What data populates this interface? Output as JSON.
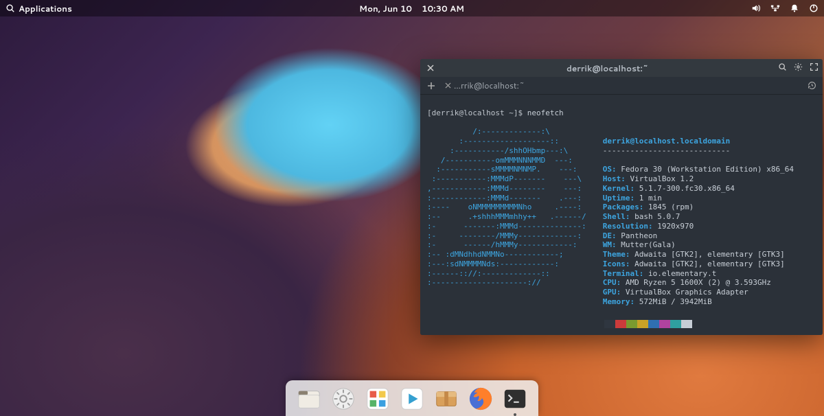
{
  "panel": {
    "applications_label": "Applications",
    "date": "Mon, Jun 10",
    "time": "10:30 AM"
  },
  "terminal": {
    "window_title": "derrik@localhost:~",
    "tab_label": "…rrik@localhost:~",
    "prompt": "[derrik@localhost ~]$",
    "command": "neofetch",
    "ascii_art": "          /:-------------:\\\n       :-------------------::\n     :-----------/shhOHbmp---:\\\n   /-----------omMMMNNNMMD  ---:\n  :-----------sMMMMNMNMP.    ---:\n :-----------:MMMdP-------    ---\\\n,------------:MMMd--------    ---:\n:------------:MMMd-------    .---:\n:----    oNMMMMMMMMMNho     .----:\n:--      .+shhhMMMmhhy++   .------/\n:-      -------:MMMd--------------:\n:-     --------/MMMy-------------:\n:-      ------/hMMMy------------:\n:-- :dMNdhhdNMMNo------------;\n:---:sdNMMMMNds:------------:\n:------:://:-------------::\n:---------------------://",
    "info_header": "derrik@localhost.localdomain",
    "info_sep": "----------------------------",
    "info": [
      {
        "label": "OS",
        "value": "Fedora 30 (Workstation Edition) x86_64"
      },
      {
        "label": "Host",
        "value": "VirtualBox 1.2"
      },
      {
        "label": "Kernel",
        "value": "5.1.7-300.fc30.x86_64"
      },
      {
        "label": "Uptime",
        "value": "1 min"
      },
      {
        "label": "Packages",
        "value": "1845 (rpm)"
      },
      {
        "label": "Shell",
        "value": "bash 5.0.7"
      },
      {
        "label": "Resolution",
        "value": "1920x970"
      },
      {
        "label": "DE",
        "value": "Pantheon"
      },
      {
        "label": "WM",
        "value": "Mutter(Gala)"
      },
      {
        "label": "Theme",
        "value": "Adwaita [GTK2], elementary [GTK3]"
      },
      {
        "label": "Icons",
        "value": "Adwaita [GTK2], elementary [GTK3]"
      },
      {
        "label": "Terminal",
        "value": "io.elementary.t"
      },
      {
        "label": "CPU",
        "value": "AMD Ryzen 5 1600X (2) @ 3.593GHz"
      },
      {
        "label": "GPU",
        "value": "VirtualBox Graphics Adapter"
      },
      {
        "label": "Memory",
        "value": "572MiB / 3942MiB"
      }
    ],
    "palette": [
      "#2f3640",
      "#cc3b3b",
      "#7a9a2f",
      "#c9a227",
      "#2f6fb2",
      "#b0439e",
      "#2fa0a0",
      "#c7ced6"
    ]
  },
  "dock": {
    "items": [
      {
        "name": "files",
        "color": "#f0ece4",
        "accent": "#8a8070"
      },
      {
        "name": "system-settings",
        "color": "#eee",
        "accent": "#999"
      },
      {
        "name": "appcenter",
        "color": "#fff",
        "accent": "#3aa0e0"
      },
      {
        "name": "music",
        "color": "#fff",
        "accent": "#f29c1f"
      },
      {
        "name": "software",
        "color": "#eee",
        "accent": "#888"
      },
      {
        "name": "firefox",
        "color": "#ff7f2a",
        "accent": "#4a6fd4"
      },
      {
        "name": "terminal",
        "color": "#2f2f2f",
        "accent": "#ddd",
        "running": true
      }
    ]
  }
}
